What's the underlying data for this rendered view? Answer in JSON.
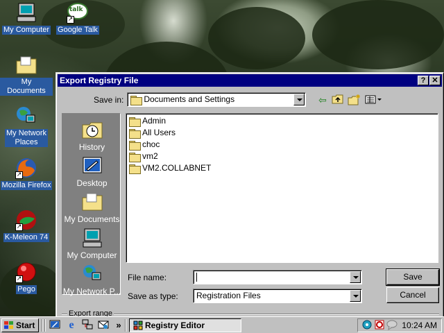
{
  "desktop": {
    "icons": [
      {
        "label": "My Computer",
        "icon": "computer-icon"
      },
      {
        "label": "Google Talk",
        "icon": "google-talk-icon"
      },
      {
        "label": "My Documents",
        "icon": "documents-folder-icon"
      },
      {
        "label": "My Network Places",
        "label_line1": "My Network",
        "label_line2": "Places",
        "icon": "network-icon"
      },
      {
        "label": "Mozilla Firefox",
        "icon": "firefox-icon"
      },
      {
        "label": "K-Meleon 74",
        "icon": "k-meleon-icon"
      },
      {
        "label": "Pego",
        "icon": "pego-icon"
      }
    ],
    "talk_badge": "talk"
  },
  "dialog": {
    "title": "Export Registry File",
    "help_button": "?",
    "close_button": "✕",
    "save_in_label": "Save in:",
    "save_in_value": "Documents and Settings",
    "toolbar_icons": [
      "back-icon",
      "up-folder-icon",
      "new-folder-icon",
      "view-menu-icon"
    ],
    "places": [
      {
        "label": "History",
        "icon": "history-icon"
      },
      {
        "label": "Desktop",
        "icon": "desktop-icon"
      },
      {
        "label": "My Documents",
        "icon": "documents-folder-icon"
      },
      {
        "label": "My Computer",
        "icon": "computer-icon"
      },
      {
        "label": "My Network P...",
        "icon": "network-icon"
      }
    ],
    "files": [
      {
        "name": "Admin"
      },
      {
        "name": "All Users"
      },
      {
        "name": "choc"
      },
      {
        "name": "vm2"
      },
      {
        "name": "VM2.COLLABNET"
      }
    ],
    "file_name_label": "File name:",
    "file_name_value": "",
    "save_as_type_label": "Save as type:",
    "save_as_type_value": "Registration Files",
    "save_button": "Save",
    "cancel_button": "Cancel",
    "export_range_label": "Export range"
  },
  "taskbar": {
    "start_label": "Start",
    "quick_launch": [
      "show-desktop-icon",
      "internet-explorer-icon",
      "network-connections-icon",
      "outlook-icon"
    ],
    "overflow": "»",
    "task_label": "Registry Editor",
    "clock": "10:24 AM",
    "tray_icons": [
      "network-tray-icon",
      "antivirus-tray-icon",
      "messenger-tray-icon"
    ]
  },
  "colors": {
    "titlebar": "#000080",
    "dialog_face": "#c0c0c0",
    "places_bar": "#808080",
    "desktop_label_bg": "#2a5aa0"
  }
}
